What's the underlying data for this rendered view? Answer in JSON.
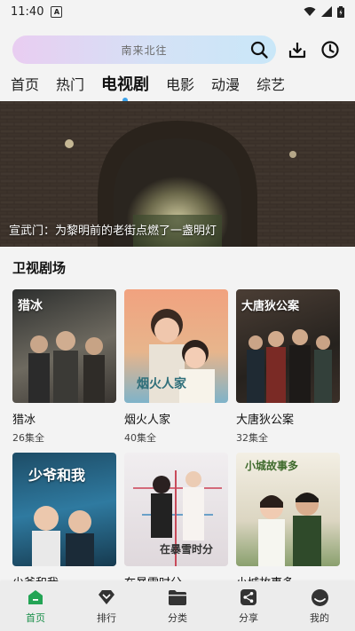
{
  "status_bar": {
    "time": "11:40",
    "notification_icon": "a-badge-icon",
    "signal_icons": [
      "wifi-icon",
      "signal-icon",
      "battery-icon"
    ]
  },
  "search": {
    "placeholder": "南来北往"
  },
  "header_icons": [
    "download-icon",
    "history-clock-icon"
  ],
  "tabs": [
    {
      "label": "首页"
    },
    {
      "label": "热门"
    },
    {
      "label": "电视剧",
      "active": true
    },
    {
      "label": "电影"
    },
    {
      "label": "动漫"
    },
    {
      "label": "综艺"
    }
  ],
  "banner": {
    "caption": "宣武门：为黎明前的老街点燃了一盏明灯"
  },
  "section": {
    "title": "卫视剧场"
  },
  "dramas": [
    {
      "name": "猎冰",
      "episodes": "26集全",
      "poster_title": "猎冰",
      "poster_color": "#5a5a56"
    },
    {
      "name": "烟火人家",
      "episodes": "40集全",
      "poster_title": "烟火人家",
      "poster_color": "#d88c72"
    },
    {
      "name": "大唐狄公案",
      "episodes": "32集全",
      "poster_title": "大唐狄公案",
      "poster_color": "#3a3530"
    },
    {
      "name": "少爷和我",
      "episodes": "",
      "poster_title": "少爷和我",
      "poster_color": "#2f6e86"
    },
    {
      "name": "在暴雪时分",
      "episodes": "",
      "poster_title": "在暴雪时分",
      "poster_color": "#d8d4d6"
    },
    {
      "name": "小城故事多",
      "episodes": "",
      "poster_title": "小城故事多",
      "poster_color": "#6a8a5a"
    }
  ],
  "bottom_nav": [
    {
      "label": "首页",
      "icon": "home-icon",
      "active": true
    },
    {
      "label": "排行",
      "icon": "rank-icon"
    },
    {
      "label": "分类",
      "icon": "folder-icon"
    },
    {
      "label": "分享",
      "icon": "share-icon"
    },
    {
      "label": "我的",
      "icon": "profile-icon"
    }
  ],
  "colors": {
    "accent": "#3aa0e8",
    "active_nav": "#1a8f4a"
  }
}
